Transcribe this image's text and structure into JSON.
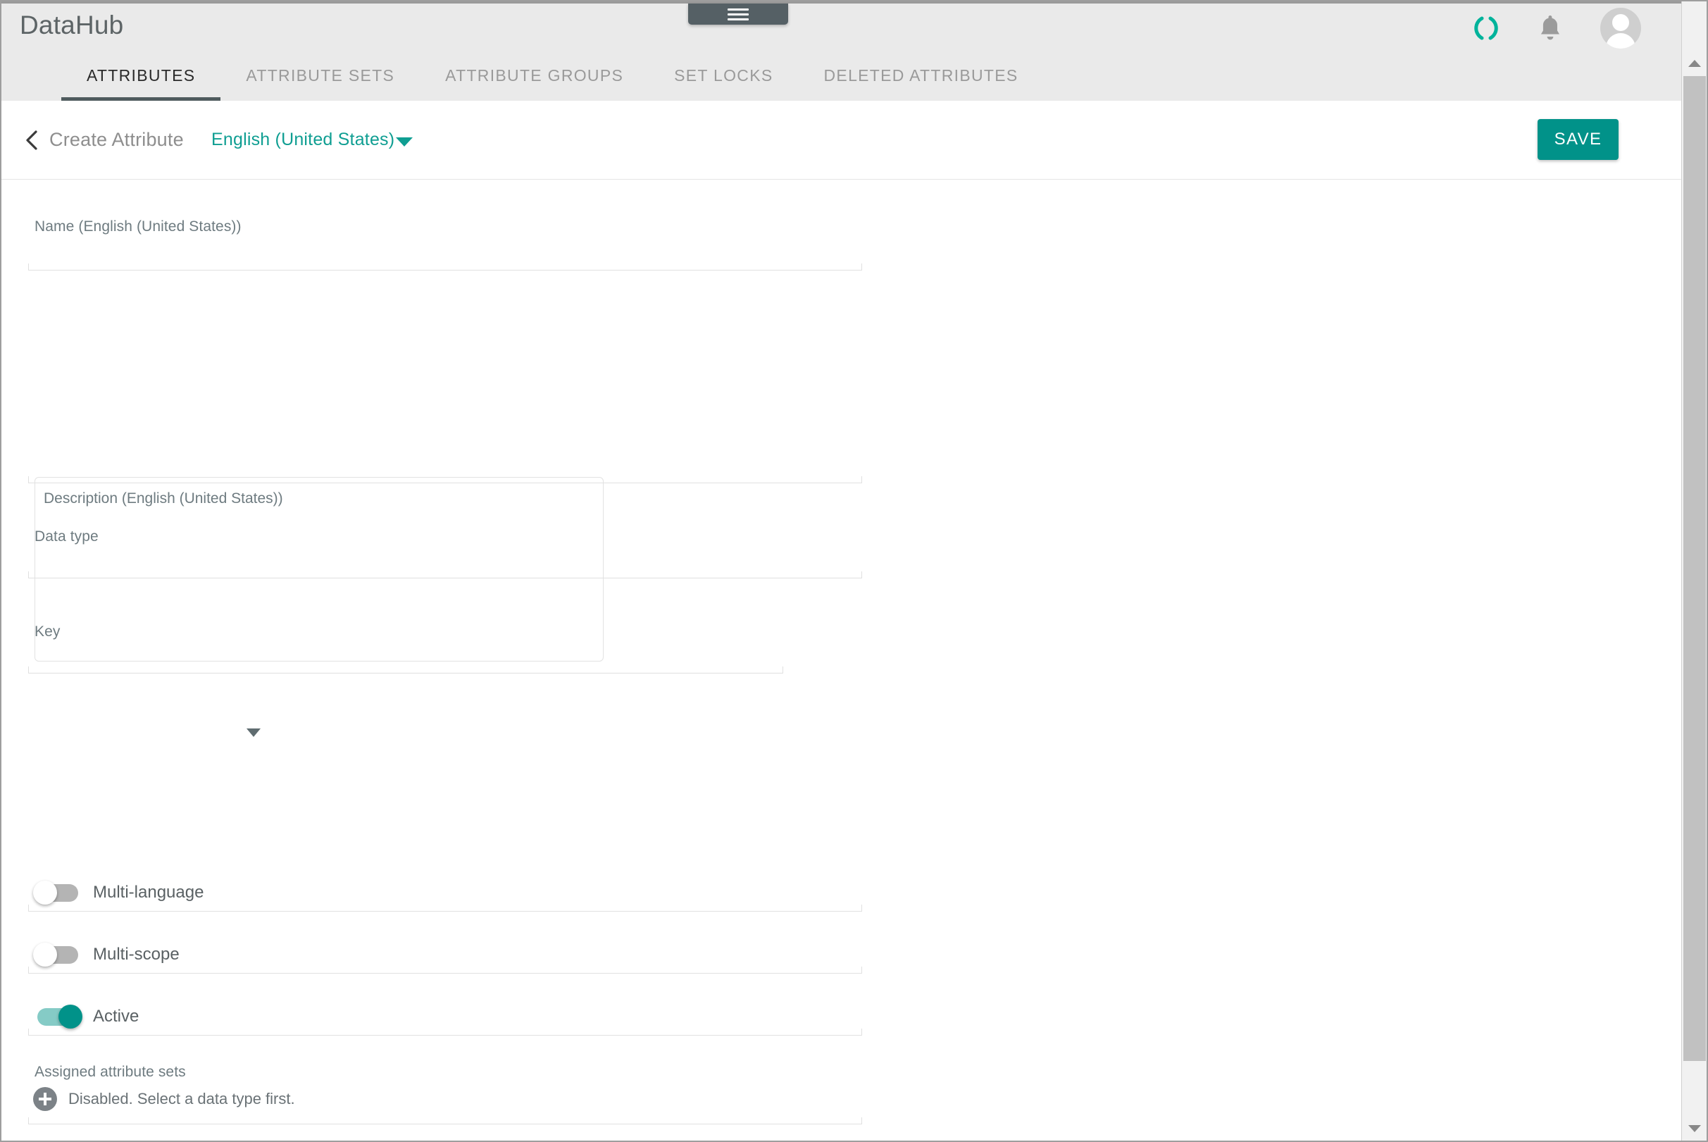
{
  "app": {
    "brand": "DataHub",
    "accent_color": "#019289",
    "tab_indicator_color": "#4f5b5e",
    "header_bg": "#eaeaea"
  },
  "topbar": {
    "drawer_handle_icon": "hamburger-menu-icon",
    "actions": [
      {
        "icon": "loading-spinner-icon",
        "color": "#00b39b"
      },
      {
        "icon": "notification-bell-icon",
        "color": "#9b9b9b"
      },
      {
        "icon": "user-avatar-icon",
        "color": "#cfcfcf"
      }
    ]
  },
  "tabs": [
    {
      "label": "ATTRIBUTES",
      "active": true
    },
    {
      "label": "ATTRIBUTE SETS",
      "active": false
    },
    {
      "label": "ATTRIBUTE GROUPS",
      "active": false
    },
    {
      "label": "SET LOCKS",
      "active": false
    },
    {
      "label": "DELETED ATTRIBUTES",
      "active": false
    }
  ],
  "subheader": {
    "back_icon": "chevron-left-icon",
    "title": "Create Attribute",
    "language": "English (United States)",
    "language_caret_icon": "chevron-down-icon",
    "save_label": "SAVE"
  },
  "form": {
    "name": {
      "label": "Name (English (United States))",
      "value": ""
    },
    "description": {
      "label": "Description (English (United States))",
      "value": ""
    },
    "data_type": {
      "label": "Data type",
      "value": "",
      "caret_icon": "dropdown-caret-icon"
    },
    "key": {
      "label": "Key",
      "value": ""
    },
    "toggles": [
      {
        "label": "Multi-language",
        "on": false
      },
      {
        "label": "Multi-scope",
        "on": false
      },
      {
        "label": "Active",
        "on": true
      }
    ],
    "assigned_attribute_sets": {
      "label": "Assigned attribute sets",
      "add_icon": "add-circle-icon",
      "note": "Disabled. Select a data type first."
    }
  },
  "scrollbar": {
    "up_icon": "scroll-up-arrow-icon",
    "down_icon": "scroll-down-arrow-icon"
  }
}
